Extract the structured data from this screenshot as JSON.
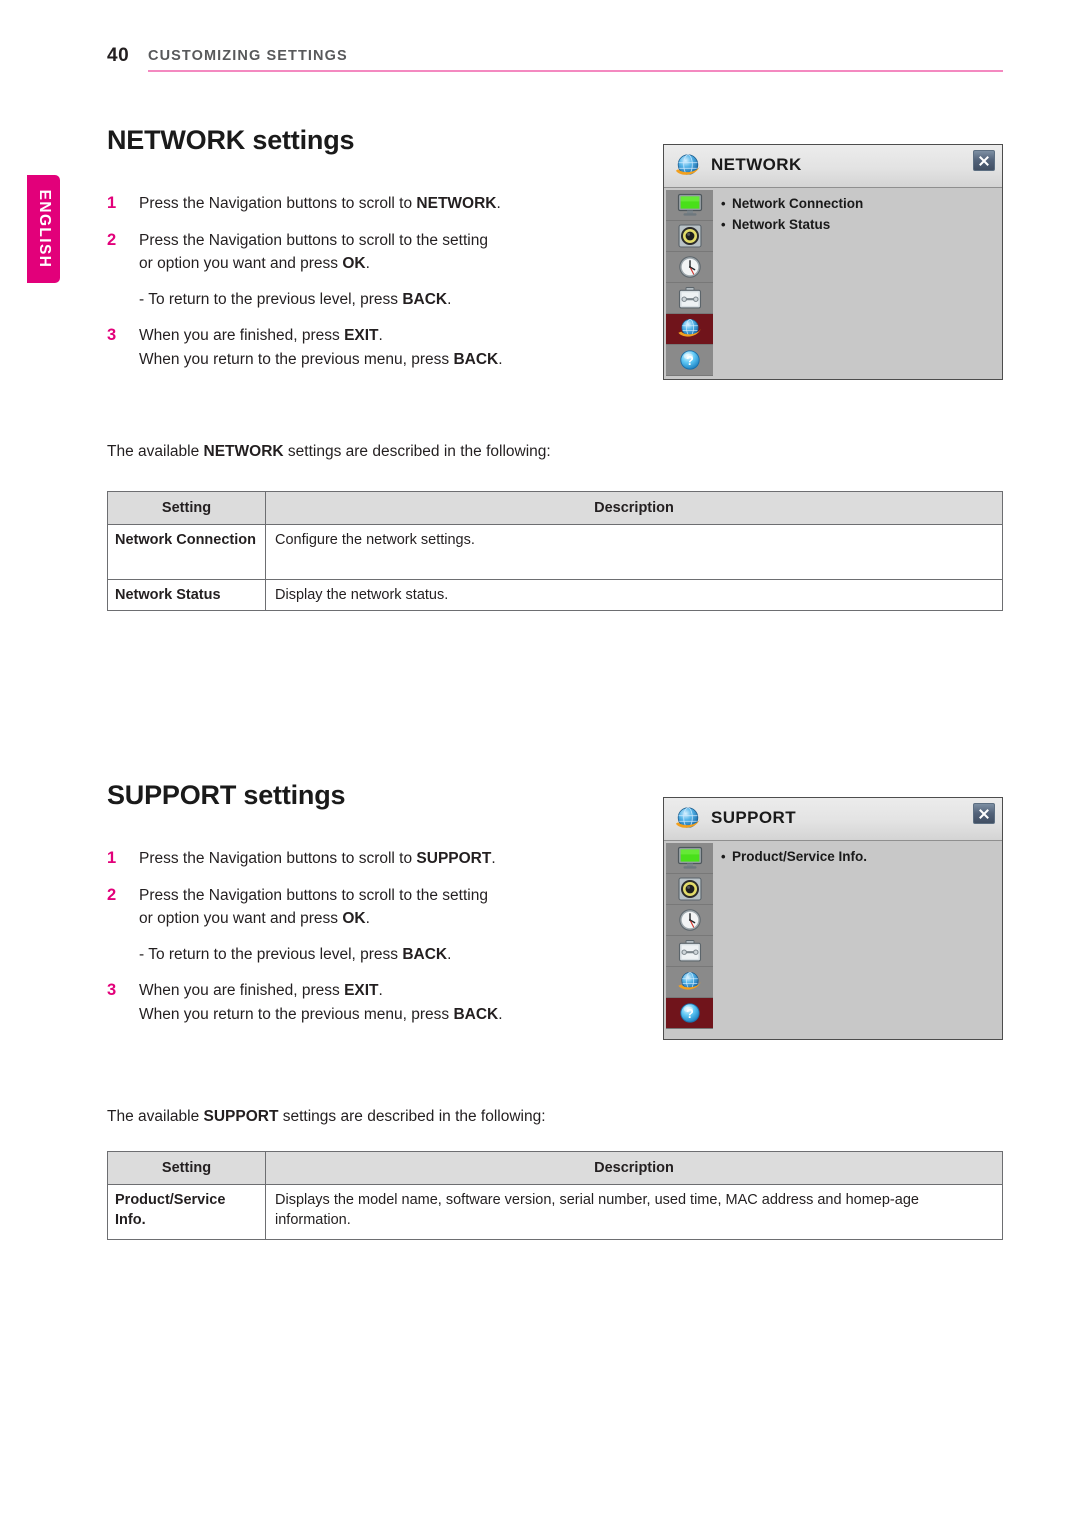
{
  "page": {
    "number": "40",
    "header_title": "CUSTOMIZING SETTINGS",
    "language_tab": "ENGLISH",
    "accent_pink": "#e2007a",
    "rule_pink": "#f489c0"
  },
  "network": {
    "heading": "NETWORK settings",
    "steps": [
      {
        "num": "1",
        "lines": [
          [
            {
              "t": "Press the Navigation buttons to scroll to ",
              "b": false
            },
            {
              "t": "NETWORK",
              "b": true
            },
            {
              "t": ".",
              "b": false
            }
          ]
        ],
        "sub": null
      },
      {
        "num": "2",
        "lines": [
          [
            {
              "t": "Press the Navigation buttons to scroll to the setting",
              "b": false
            }
          ],
          [
            {
              "t": "or option you want and press ",
              "b": false
            },
            {
              "t": "OK",
              "b": true
            },
            {
              "t": ".",
              "b": false
            }
          ]
        ],
        "sub": [
          {
            "t": "- To return to the previous level, press ",
            "b": false
          },
          {
            "t": "BACK",
            "b": true
          },
          {
            "t": ".",
            "b": false
          }
        ]
      },
      {
        "num": "3",
        "lines": [
          [
            {
              "t": "When you are finished, press ",
              "b": false
            },
            {
              "t": "EXIT",
              "b": true
            },
            {
              "t": ".",
              "b": false
            }
          ],
          [
            {
              "t": "When you return to the previous menu, press ",
              "b": false
            },
            {
              "t": "BACK",
              "b": true
            },
            {
              "t": ".",
              "b": false
            }
          ]
        ],
        "sub": null
      }
    ],
    "available_line": [
      {
        "t": "The available ",
        "b": false
      },
      {
        "t": "NETWORK",
        "b": true
      },
      {
        "t": " settings are described in the following:",
        "b": false
      }
    ],
    "table": {
      "headers": [
        "Setting",
        "Description"
      ],
      "rows": [
        {
          "setting": "Network Connection",
          "description": "Configure the network settings.",
          "tall": true
        },
        {
          "setting": "Network Status",
          "description": "Display the network status.",
          "tall": false
        }
      ]
    },
    "osd": {
      "title": "NETWORK",
      "title_icon": "globe-icon",
      "close_label": "close",
      "rail": [
        {
          "icon": "display-monitor-icon",
          "active": false
        },
        {
          "icon": "speaker-audio-icon",
          "active": false
        },
        {
          "icon": "clock-time-icon",
          "active": false
        },
        {
          "icon": "toolbox-options-icon",
          "active": false
        },
        {
          "icon": "globe-network-icon",
          "active": true
        },
        {
          "icon": "question-help-icon",
          "active": false
        }
      ],
      "items": [
        "Network Connection",
        "Network Status"
      ],
      "bullet": "•"
    }
  },
  "support": {
    "heading": "SUPPORT settings",
    "steps": [
      {
        "num": "1",
        "lines": [
          [
            {
              "t": "Press the Navigation buttons to scroll to ",
              "b": false
            },
            {
              "t": "SUPPORT",
              "b": true
            },
            {
              "t": ".",
              "b": false
            }
          ]
        ],
        "sub": null
      },
      {
        "num": "2",
        "lines": [
          [
            {
              "t": "Press the Navigation buttons to scroll to the setting",
              "b": false
            }
          ],
          [
            {
              "t": "or option you want and press ",
              "b": false
            },
            {
              "t": "OK",
              "b": true
            },
            {
              "t": ".",
              "b": false
            }
          ]
        ],
        "sub": [
          {
            "t": "- To return to the previous level, press ",
            "b": false
          },
          {
            "t": "BACK",
            "b": true
          },
          {
            "t": ".",
            "b": false
          }
        ]
      },
      {
        "num": "3",
        "lines": [
          [
            {
              "t": "When you are finished, press ",
              "b": false
            },
            {
              "t": "EXIT",
              "b": true
            },
            {
              "t": ".",
              "b": false
            }
          ],
          [
            {
              "t": "When you return to the previous menu, press ",
              "b": false
            },
            {
              "t": "BACK",
              "b": true
            },
            {
              "t": ".",
              "b": false
            }
          ]
        ],
        "sub": null
      }
    ],
    "available_line": [
      {
        "t": "The available ",
        "b": false
      },
      {
        "t": "SUPPORT",
        "b": true
      },
      {
        "t": " settings are described in the following:",
        "b": false
      }
    ],
    "table": {
      "headers": [
        "Setting",
        "Description"
      ],
      "rows": [
        {
          "setting": "Product/Service Info.",
          "description": "Displays the model name, software version, serial number, used time, MAC address and homep-age information.",
          "tall": true
        }
      ]
    },
    "osd": {
      "title": "SUPPORT",
      "title_icon": "globe-icon",
      "close_label": "close",
      "rail": [
        {
          "icon": "display-monitor-icon",
          "active": false
        },
        {
          "icon": "speaker-audio-icon",
          "active": false
        },
        {
          "icon": "clock-time-icon",
          "active": false
        },
        {
          "icon": "toolbox-options-icon",
          "active": false
        },
        {
          "icon": "globe-network-icon",
          "active": false
        },
        {
          "icon": "question-help-icon",
          "active": true
        }
      ],
      "items": [
        "Product/Service Info."
      ],
      "bullet": "•"
    }
  }
}
